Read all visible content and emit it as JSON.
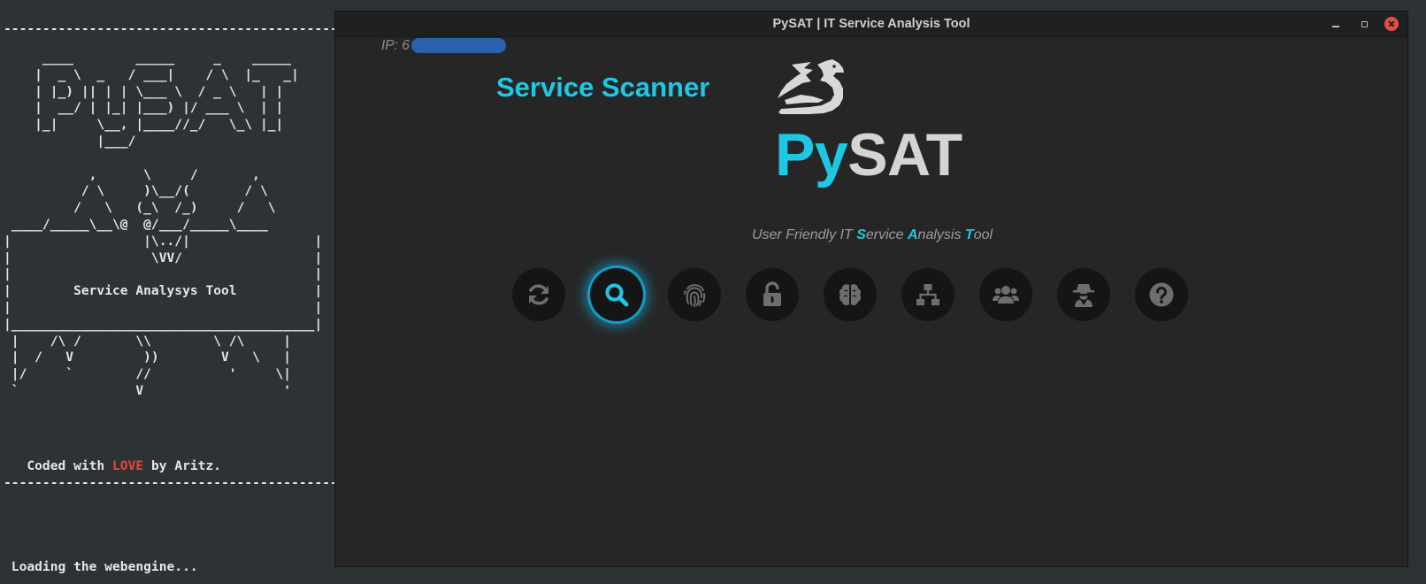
{
  "terminal": {
    "rule_top": "-------------------------------------------",
    "ascii_art": "     ____        _____     _    _____\n    |  _ \\  _   / ___|    / \\  |_   _|\n    | |_) || | | \\___ \\  / _ \\   | |\n    |  __/ | |_| |___) |/ ___ \\  | |\n    |_|     \\__, |____//_/   \\_\\ |_|\n            |___/\n\n           ,      \\     /       ,\n          / \\     )\\__/(       / \\\n         /   \\   (_\\  /_)     /   \\\n ____/_____\\__\\@  @/___/_____\\____\n|                 |\\../|                |\n|                  \\VV/                 |\n|                                       |\n|        Service Analysys Tool          |\n|                                       |\n|_______________________________________|\n |    /\\ /       \\\\        \\ /\\     |\n |  /   V         ))        V   \\   |\n |/     `        //          '     \\|\n `               V                  '",
    "coded_prefix": "   Coded with ",
    "coded_love": "LOVE",
    "coded_suffix": " by Aritz.",
    "rule_bottom": "-------------------------------------------",
    "loading": " Loading the webengine..."
  },
  "window": {
    "title": "PySAT | IT Service Analysis Tool",
    "controls": [
      "minimize",
      "maximize",
      "close"
    ]
  },
  "app": {
    "ip_label": "IP: ",
    "ip_value_visible": "6",
    "section_title": "Service Scanner",
    "brand_py": "Py",
    "brand_sat": "SAT",
    "tagline": {
      "p1": "User Friendly IT ",
      "s": "S",
      "p2": "ervice ",
      "a": "A",
      "p3": "nalysis ",
      "t": "T",
      "p4": "ool"
    },
    "tools": [
      {
        "icon": "sync-icon",
        "active": false
      },
      {
        "icon": "search-icon",
        "active": true
      },
      {
        "icon": "fingerprint-icon",
        "active": false
      },
      {
        "icon": "unlock-icon",
        "active": false
      },
      {
        "icon": "brain-icon",
        "active": false
      },
      {
        "icon": "network-icon",
        "active": false
      },
      {
        "icon": "users-icon",
        "active": false
      },
      {
        "icon": "spy-icon",
        "active": false
      },
      {
        "icon": "help-icon",
        "active": false
      }
    ]
  },
  "colors": {
    "accent": "#1ec8e5",
    "love": "#e8453c",
    "icon_inactive": "#6e6e6e",
    "background": "#262626"
  }
}
